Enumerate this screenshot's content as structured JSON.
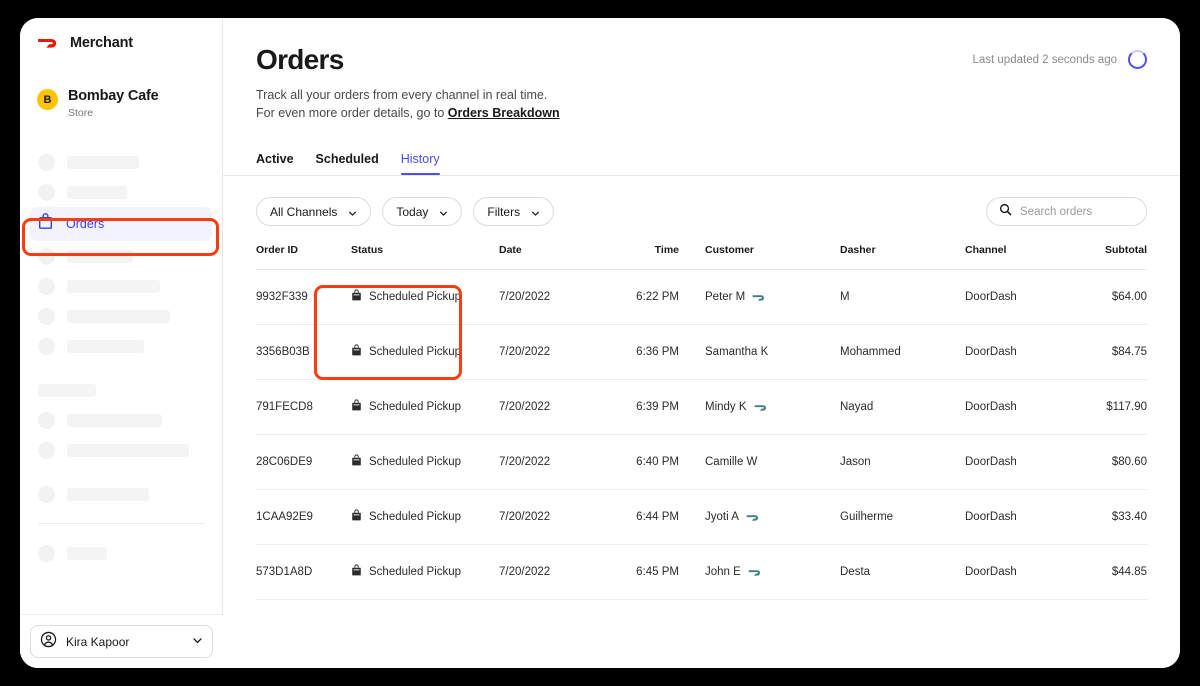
{
  "sidebar": {
    "brand": {
      "logo_icon": "doordash-logo-icon",
      "label": "Merchant"
    },
    "store": {
      "avatar_initial": "B",
      "name": "Bombay Cafe",
      "subtitle": "Store"
    },
    "active_item": {
      "icon": "order-bag-icon",
      "label": "Orders"
    },
    "user": {
      "icon": "user-avatar-icon",
      "name": "Kira Kapoor",
      "chevron": "chevron-down-icon"
    },
    "skeleton_widths": [
      72,
      60,
      0,
      66,
      93,
      103,
      77,
      58,
      95,
      122,
      82,
      40
    ]
  },
  "header": {
    "title": "Orders",
    "subtitle_line1": "Track all your orders from every channel in real time.",
    "subtitle_line2_prefix": "For even more order details, go to ",
    "subtitle_link": "Orders Breakdown",
    "last_updated": "Last updated 2 seconds ago",
    "spinner_icon": "loading-spinner-icon"
  },
  "tabs": [
    {
      "label": "Active",
      "active": false
    },
    {
      "label": "Scheduled",
      "active": false
    },
    {
      "label": "History",
      "active": true
    }
  ],
  "filters": {
    "channel": {
      "label": "All Channels",
      "chevron": "chevron-down-icon"
    },
    "date": {
      "label": "Today",
      "chevron": "chevron-down-icon"
    },
    "more": {
      "label": "Filters",
      "chevron": "chevron-down-icon"
    },
    "search": {
      "icon": "search-icon",
      "placeholder": "Search orders",
      "value": ""
    }
  },
  "table": {
    "columns": [
      "Order ID",
      "Status",
      "Date",
      "Time",
      "Customer",
      "Dasher",
      "Channel",
      "Subtotal"
    ],
    "rows": [
      {
        "order_id": "9932F339",
        "status_icon": "order-bag-icon",
        "status": "Scheduled Pickup",
        "date": "7/20/2022",
        "time": "6:22 PM",
        "customer": "Peter M",
        "dashpass": true,
        "dasher": "M",
        "channel": "DoorDash",
        "subtotal": "$64.00"
      },
      {
        "order_id": "3356B03B",
        "status_icon": "order-bag-icon",
        "status": "Scheduled Pickup",
        "date": "7/20/2022",
        "time": "6:36 PM",
        "customer": "Samantha K",
        "dashpass": false,
        "dasher": "Mohammed",
        "channel": "DoorDash",
        "subtotal": "$84.75"
      },
      {
        "order_id": "791FECD8",
        "status_icon": "order-bag-icon",
        "status": "Scheduled Pickup",
        "date": "7/20/2022",
        "time": "6:39 PM",
        "customer": "Mindy K",
        "dashpass": true,
        "dasher": "Nayad",
        "channel": "DoorDash",
        "subtotal": "$117.90"
      },
      {
        "order_id": "28C06DE9",
        "status_icon": "order-bag-icon",
        "status": "Scheduled Pickup",
        "date": "7/20/2022",
        "time": "6:40 PM",
        "customer": "Camille W",
        "dashpass": false,
        "dasher": "Jason",
        "channel": "DoorDash",
        "subtotal": "$80.60"
      },
      {
        "order_id": "1CAA92E9",
        "status_icon": "order-bag-icon",
        "status": "Scheduled Pickup",
        "date": "7/20/2022",
        "time": "6:44 PM",
        "customer": "Jyoti A",
        "dashpass": true,
        "dasher": "Guilherme",
        "channel": "DoorDash",
        "subtotal": "$33.40"
      },
      {
        "order_id": "573D1A8D",
        "status_icon": "order-bag-icon",
        "status": "Scheduled Pickup",
        "date": "7/20/2022",
        "time": "6:45 PM",
        "customer": "John E",
        "dashpass": true,
        "dasher": "Desta",
        "channel": "DoorDash",
        "subtotal": "$44.85"
      }
    ]
  },
  "annotations": {
    "highlight_color": "#fa3c10",
    "boxes": [
      "sidebar-orders-item",
      "status-column"
    ]
  },
  "colors": {
    "accent_blue": "#4b4bf3",
    "brand_red": "#eb1700",
    "store_badge_yellow": "#ffc400",
    "dashpass_teal": "#3f7e81",
    "annotation_red": "#fa3c10"
  }
}
